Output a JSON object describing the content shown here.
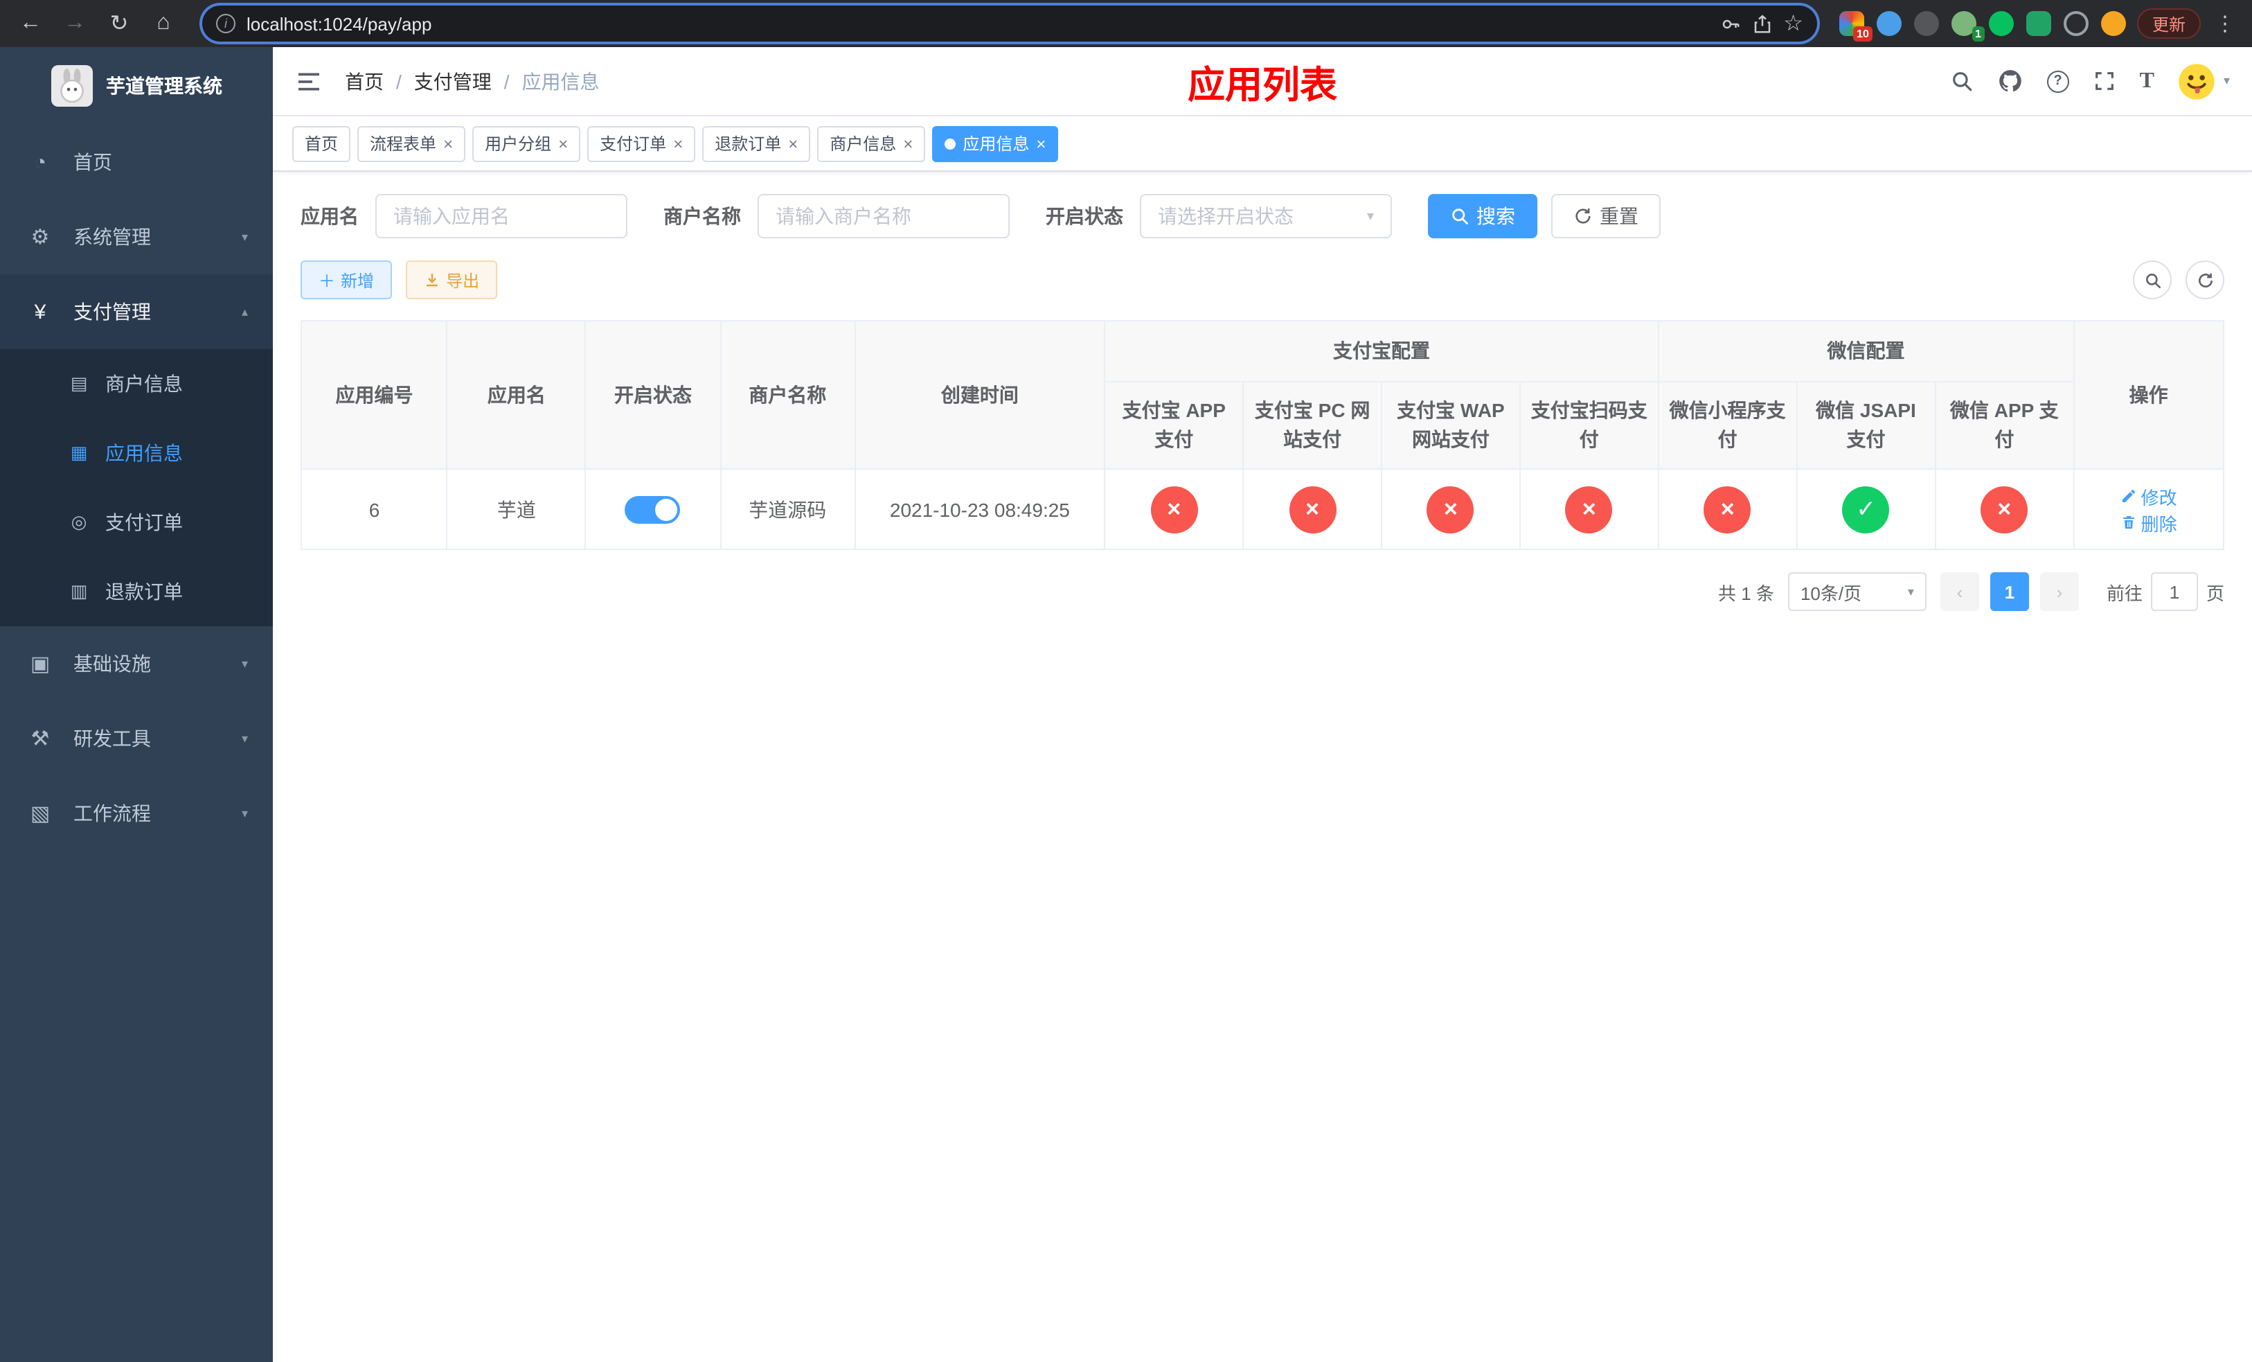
{
  "colors": {
    "accent": "#409eff",
    "success": "#13ce66",
    "danger": "#f9564f",
    "page_title": "#ff0000",
    "sidebar_bg": "#304156",
    "submenu_bg": "#1f2d3d"
  },
  "browser": {
    "url": "localhost:1024/pay/app",
    "update_label": "更新",
    "ext_badge_puzzle": "10",
    "ext_badge_green": "1"
  },
  "sidebar": {
    "title": "芋道管理系统",
    "items": [
      {
        "label": "首页",
        "icon": "dashboard-icon"
      },
      {
        "label": "系统管理",
        "icon": "gear-icon"
      },
      {
        "label": "支付管理",
        "icon": "yen-icon"
      },
      {
        "label": "基础设施",
        "icon": "infrastructure-icon"
      },
      {
        "label": "研发工具",
        "icon": "devtools-icon"
      },
      {
        "label": "工作流程",
        "icon": "workflow-icon"
      }
    ],
    "payment_children": [
      {
        "label": "商户信息",
        "icon": "merchant-icon"
      },
      {
        "label": "应用信息",
        "icon": "app-grid-icon",
        "active": true
      },
      {
        "label": "支付订单",
        "icon": "pay-order-icon"
      },
      {
        "label": "退款订单",
        "icon": "refund-order-icon"
      }
    ]
  },
  "breadcrumb": [
    "首页",
    "支付管理",
    "应用信息"
  ],
  "header": {
    "page_title": "应用列表"
  },
  "tabs": [
    {
      "label": "首页",
      "closable": false,
      "active": false
    },
    {
      "label": "流程表单",
      "closable": true,
      "active": false
    },
    {
      "label": "用户分组",
      "closable": true,
      "active": false
    },
    {
      "label": "支付订单",
      "closable": true,
      "active": false
    },
    {
      "label": "退款订单",
      "closable": true,
      "active": false
    },
    {
      "label": "商户信息",
      "closable": true,
      "active": false
    },
    {
      "label": "应用信息",
      "closable": true,
      "active": true
    }
  ],
  "filters": {
    "app_name_label": "应用名",
    "app_name_placeholder": "请输入应用名",
    "merchant_label": "商户名称",
    "merchant_placeholder": "请输入商户名称",
    "status_label": "开启状态",
    "status_placeholder": "请选择开启状态",
    "search_button": "搜索",
    "reset_button": "重置"
  },
  "toolbar": {
    "add_button": "新增",
    "export_button": "导出"
  },
  "table": {
    "col_app_id": "应用编号",
    "col_app_name": "应用名",
    "col_status": "开启状态",
    "col_merchant": "商户名称",
    "col_created": "创建时间",
    "group_alipay": "支付宝配置",
    "group_wechat": "微信配置",
    "col_alipay_app": "支付宝 APP 支付",
    "col_alipay_pc": "支付宝 PC 网站支付",
    "col_alipay_wap": "支付宝 WAP 网站支付",
    "col_alipay_qr": "支付宝扫码支付",
    "col_wx_mini": "微信小程序支付",
    "col_wx_jsapi": "微信 JSAPI 支付",
    "col_wx_app": "微信 APP 支付",
    "col_actions": "操作",
    "rows": [
      {
        "app_id": "6",
        "app_name": "芋道",
        "enabled": true,
        "merchant": "芋道源码",
        "created": "2021-10-23 08:49:25",
        "configs": [
          false,
          false,
          false,
          false,
          false,
          true,
          false
        ],
        "edit_label": "修改",
        "delete_label": "删除"
      }
    ]
  },
  "pagination": {
    "total": "共 1 条",
    "page_size": "10条/页",
    "page": "1",
    "goto_label": "前往",
    "goto_value": "1",
    "page_unit": "页"
  }
}
